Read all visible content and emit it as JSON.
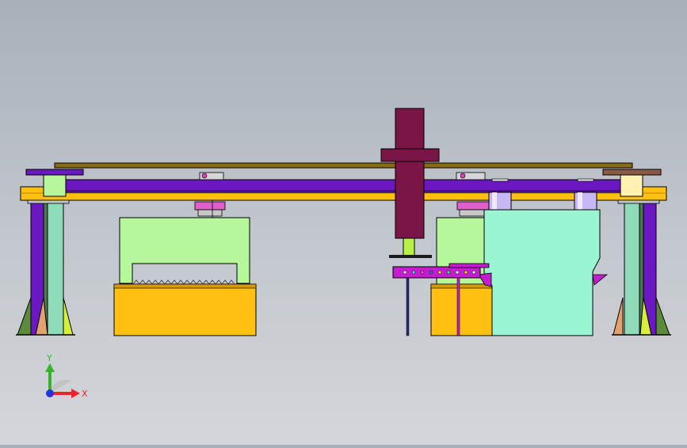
{
  "viewport": {
    "background_top": "#a9b0ba",
    "background_bottom": "#d3d6da"
  },
  "triad": {
    "x_label": "X",
    "y_label": "Y",
    "x_color": "#e8252b",
    "y_color": "#35b32a",
    "z_color": "#2334d6"
  },
  "colors": {
    "purple": "#6b17c2",
    "yellow": "#ffc012",
    "maroon": "#7a1645",
    "light_green": "#b5f79a",
    "mint": "#99f5d2",
    "magenta": "#c51ccf",
    "olive_rail": "#8b6b14",
    "brown_cap": "#8a5a44"
  }
}
